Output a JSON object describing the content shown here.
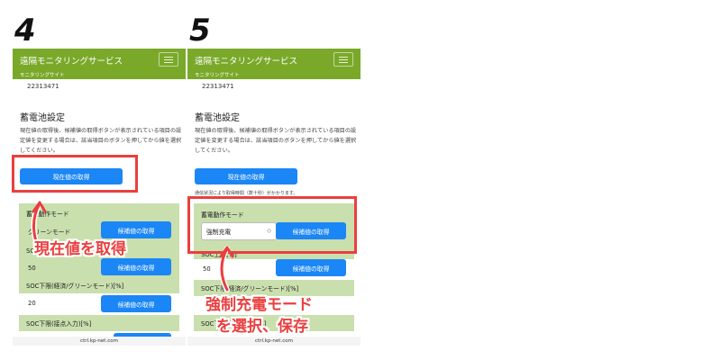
{
  "panels": [
    {
      "step": "4",
      "app": {
        "title": "遠隔モニタリングサービス",
        "subtitle": "モニタリングサイト"
      },
      "device_id": "22313471",
      "page_title": "蓄電池設定",
      "description": "現在値の取得後、候補値の取得ボタンが表示されている項目の設定値を変更する場合は、該当項目のボタンを押してから値を選択してください。",
      "get_current_button": "現在値の取得",
      "sections": [
        {
          "label": "蓄電動作モード",
          "value": "グリーンモード",
          "button": "候補値の取得"
        },
        {
          "label": "SOC上限[%]",
          "value": "50",
          "button": "候補値の取得"
        },
        {
          "label": "SOC下限(経済/グリーンモード)[%]",
          "value": "20",
          "button": "候補値の取得"
        },
        {
          "label": "SOC下限(接点入力)[%]",
          "value": "",
          "button": ""
        }
      ],
      "url": "ctrl.kp-net.com",
      "annotation": "現在値を取得"
    },
    {
      "step": "5",
      "app": {
        "title": "遠隔モニタリングサービス",
        "subtitle": "モニタリングサイト"
      },
      "device_id": "22313471",
      "page_title": "蓄電池設定",
      "description": "現在値の取得後、候補値の取得ボタンが表示されている項目の設定値を変更する場合は、該当項目のボタンを押してから値を選択してください。",
      "get_current_button": "現在値の取得",
      "hint": "通信状況により取得時間（数十秒）がかかります。",
      "sections": [
        {
          "label": "蓄電動作モード",
          "value": "強制充電",
          "button": "候補値の取得"
        },
        {
          "label": "SOC上限[%]",
          "value": "50",
          "button": "候補値の取得"
        },
        {
          "label": "SOC下限(経済/グリーンモード)[%]",
          "value": "",
          "button": ""
        },
        {
          "label": "SOC下限(接点入力)[%]",
          "value": "",
          "button": ""
        }
      ],
      "url": "ctrl.kp-net.com",
      "annotation_line1": "強制充電モード",
      "annotation_line2": "を選択、保存"
    }
  ],
  "colors": {
    "header_green": "#7aa92a",
    "block_green": "#cadfae",
    "button_blue": "#1b86f5",
    "highlight_red": "#ea3f3f"
  },
  "icons": {
    "menu": "hamburger-icon",
    "select": "updown-chevron-icon",
    "annotation_arrow": "curved-arrow-icon"
  }
}
